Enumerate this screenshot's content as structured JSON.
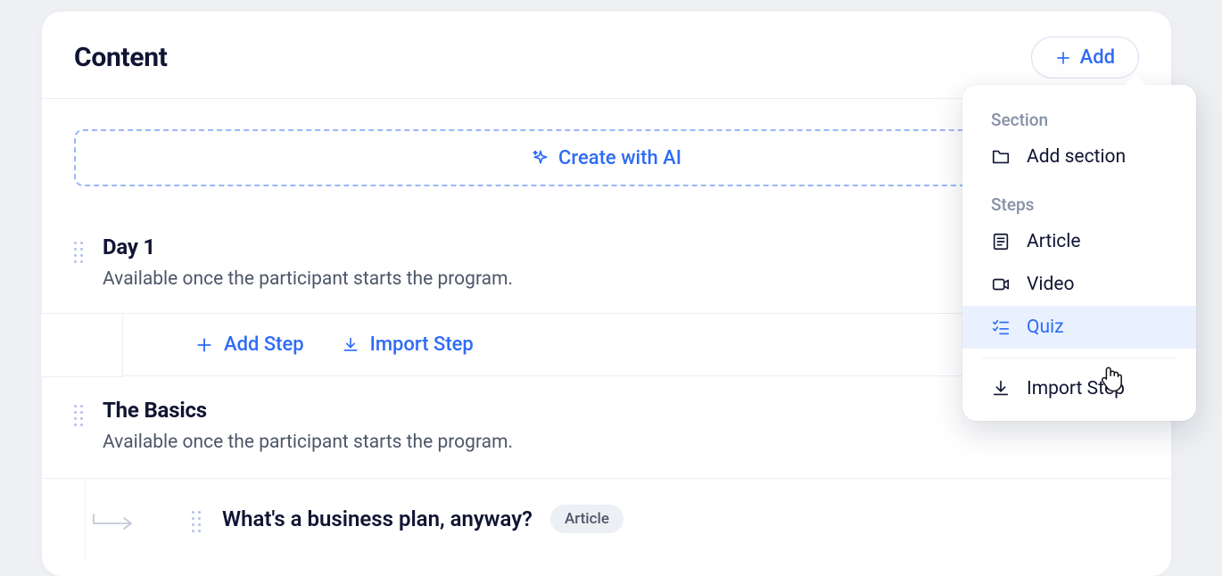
{
  "header": {
    "title": "Content",
    "add_label": "Add"
  },
  "ai_banner": {
    "label": "Create with AI"
  },
  "sections": [
    {
      "title": "Day 1",
      "subtitle": "Available once the participant starts the program.",
      "actions": {
        "add_step": "Add Step",
        "import_step": "Import Step"
      }
    },
    {
      "title": "The Basics",
      "subtitle": "Available once the participant starts the program.",
      "steps": [
        {
          "title": "What's a business plan, anyway?",
          "type_label": "Article"
        }
      ]
    }
  ],
  "dropdown": {
    "section_group_label": "Section",
    "add_section": "Add section",
    "steps_group_label": "Steps",
    "article": "Article",
    "video": "Video",
    "quiz": "Quiz",
    "import_step": "Import Step"
  }
}
